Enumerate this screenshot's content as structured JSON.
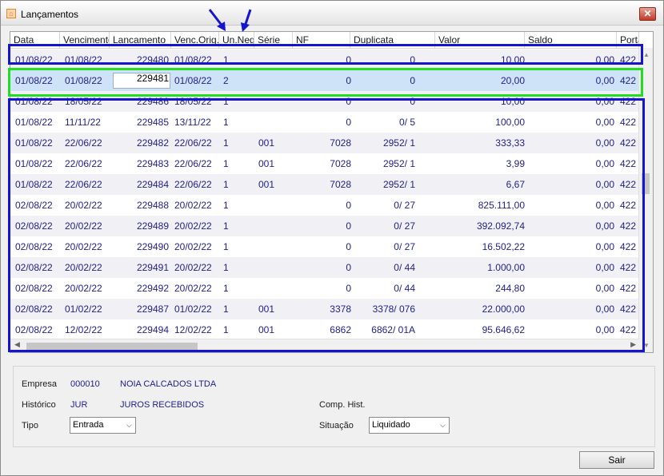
{
  "window": {
    "title": "Lançamentos",
    "close_label": "✕"
  },
  "grid": {
    "columns": [
      "Data",
      "Vencimento",
      "Lancamento",
      "Venc.Orig.",
      "Un.Neg.",
      "Série",
      "NF",
      "Duplicata",
      "Valor",
      "Saldo",
      "Porta"
    ],
    "selected_row_index": 1,
    "rows": [
      {
        "data": "01/08/22",
        "vencimento": "01/08/22",
        "lancamento": "229480",
        "venc_orig": "01/08/22",
        "un_neg": "1",
        "serie": "",
        "nf": "0",
        "duplicata": "0",
        "valor": "10,00",
        "saldo": "0,00",
        "porta": "422"
      },
      {
        "data": "01/08/22",
        "vencimento": "01/08/22",
        "lancamento": "229481",
        "venc_orig": "01/08/22",
        "un_neg": "2",
        "serie": "",
        "nf": "0",
        "duplicata": "0",
        "valor": "20,00",
        "saldo": "0,00",
        "porta": "422"
      },
      {
        "data": "01/08/22",
        "vencimento": "18/05/22",
        "lancamento": "229486",
        "venc_orig": "18/05/22",
        "un_neg": "1",
        "serie": "",
        "nf": "0",
        "duplicata": "0",
        "valor": "10,00",
        "saldo": "0,00",
        "porta": "422"
      },
      {
        "data": "01/08/22",
        "vencimento": "11/11/22",
        "lancamento": "229485",
        "venc_orig": "13/11/22",
        "un_neg": "1",
        "serie": "",
        "nf": "0",
        "duplicata": "0/ 5",
        "valor": "100,00",
        "saldo": "0,00",
        "porta": "422"
      },
      {
        "data": "01/08/22",
        "vencimento": "22/06/22",
        "lancamento": "229482",
        "venc_orig": "22/06/22",
        "un_neg": "1",
        "serie": "001",
        "nf": "7028",
        "duplicata": "2952/ 1",
        "valor": "333,33",
        "saldo": "0,00",
        "porta": "422"
      },
      {
        "data": "01/08/22",
        "vencimento": "22/06/22",
        "lancamento": "229483",
        "venc_orig": "22/06/22",
        "un_neg": "1",
        "serie": "001",
        "nf": "7028",
        "duplicata": "2952/ 1",
        "valor": "3,99",
        "saldo": "0,00",
        "porta": "422"
      },
      {
        "data": "01/08/22",
        "vencimento": "22/06/22",
        "lancamento": "229484",
        "venc_orig": "22/06/22",
        "un_neg": "1",
        "serie": "001",
        "nf": "7028",
        "duplicata": "2952/ 1",
        "valor": "6,67",
        "saldo": "0,00",
        "porta": "422"
      },
      {
        "data": "02/08/22",
        "vencimento": "20/02/22",
        "lancamento": "229488",
        "venc_orig": "20/02/22",
        "un_neg": "1",
        "serie": "",
        "nf": "0",
        "duplicata": "0/ 27",
        "valor": "825.111,00",
        "saldo": "0,00",
        "porta": "422"
      },
      {
        "data": "02/08/22",
        "vencimento": "20/02/22",
        "lancamento": "229489",
        "venc_orig": "20/02/22",
        "un_neg": "1",
        "serie": "",
        "nf": "0",
        "duplicata": "0/ 27",
        "valor": "392.092,74",
        "saldo": "0,00",
        "porta": "422"
      },
      {
        "data": "02/08/22",
        "vencimento": "20/02/22",
        "lancamento": "229490",
        "venc_orig": "20/02/22",
        "un_neg": "1",
        "serie": "",
        "nf": "0",
        "duplicata": "0/ 27",
        "valor": "16.502,22",
        "saldo": "0,00",
        "porta": "422"
      },
      {
        "data": "02/08/22",
        "vencimento": "20/02/22",
        "lancamento": "229491",
        "venc_orig": "20/02/22",
        "un_neg": "1",
        "serie": "",
        "nf": "0",
        "duplicata": "0/ 44",
        "valor": "1.000,00",
        "saldo": "0,00",
        "porta": "422"
      },
      {
        "data": "02/08/22",
        "vencimento": "20/02/22",
        "lancamento": "229492",
        "venc_orig": "20/02/22",
        "un_neg": "1",
        "serie": "",
        "nf": "0",
        "duplicata": "0/ 44",
        "valor": "244,80",
        "saldo": "0,00",
        "porta": "422"
      },
      {
        "data": "02/08/22",
        "vencimento": "01/02/22",
        "lancamento": "229487",
        "venc_orig": "01/02/22",
        "un_neg": "1",
        "serie": "001",
        "nf": "3378",
        "duplicata": "3378/ 076",
        "valor": "22.000,00",
        "saldo": "0,00",
        "porta": "422"
      },
      {
        "data": "02/08/22",
        "vencimento": "12/02/22",
        "lancamento": "229494",
        "venc_orig": "12/02/22",
        "un_neg": "1",
        "serie": "001",
        "nf": "6862",
        "duplicata": "6862/ 01A",
        "valor": "95.646,62",
        "saldo": "0,00",
        "porta": "422"
      }
    ]
  },
  "annotations": {
    "blue": "#1515d0",
    "green": "#22dd22"
  },
  "info": {
    "empresa_label": "Empresa",
    "empresa_code": "000010",
    "empresa_name": "NOIA CALCADOS LTDA",
    "historico_label": "Histórico",
    "historico_code": "JUR",
    "historico_name": "JUROS RECEBIDOS",
    "comp_hist_label": "Comp. Hist.",
    "tipo_label": "Tipo",
    "tipo_value": "Entrada",
    "situacao_label": "Situação",
    "situacao_value": "Liquidado"
  },
  "buttons": {
    "sair": "Sair"
  }
}
